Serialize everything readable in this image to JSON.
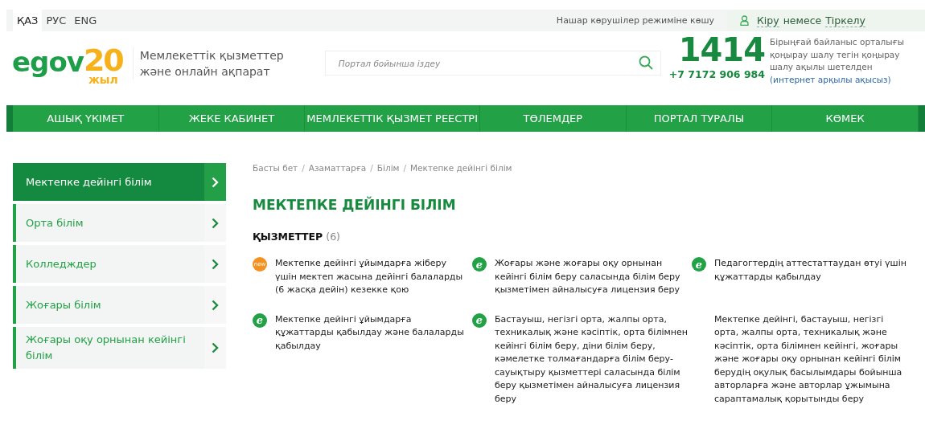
{
  "top_bar": {
    "languages": [
      {
        "label": "ҚАЗ",
        "selected": true
      },
      {
        "label": "РУС",
        "selected": false
      },
      {
        "label": "ENG",
        "selected": false
      }
    ],
    "accessibility_link": "Нашар көрушілер режиміне көшу",
    "login": {
      "sign_in": "Кіру",
      "separator": "немесе",
      "register": "Тіркелу"
    }
  },
  "header": {
    "logo": {
      "word": "egov",
      "number": "20",
      "suffix": "жыл"
    },
    "tagline": [
      "Мемлекеттік қызметтер",
      "және онлайн ақпарат"
    ],
    "search": {
      "placeholder": "Портал бойынша іздеу"
    },
    "contact": {
      "short_number": "1414",
      "phone": "+7 7172 906 984",
      "text": "Бірыңғай байланыс орталығы қоңырау шалу тегін қоңырау шалу ақылы шетелден",
      "link": "(интернет арқылы ақысыз)"
    }
  },
  "nav": [
    "АШЫҚ ҮКІМЕТ",
    "ЖЕКЕ КАБИНЕТ",
    "МЕМЛЕКЕТТІК ҚЫЗМЕТ РЕЕСТРІ",
    "ТӨЛЕМДЕР",
    "ПОРТАЛ ТУРАЛЫ",
    "КӨМЕК"
  ],
  "sidebar": {
    "items": [
      {
        "label": "Мектепке дейінгі білім",
        "selected": true
      },
      {
        "label": "Орта білім",
        "selected": false
      },
      {
        "label": "Колледждер",
        "selected": false
      },
      {
        "label": "Жоғары білім",
        "selected": false
      },
      {
        "label": "Жоғары оқу орнынан кейінгі білім",
        "selected": false
      }
    ]
  },
  "breadcrumbs": [
    "Басты бет",
    "Азаматтарға",
    "Білім",
    "Мектепке дейінгі білім"
  ],
  "breadcrumb_separator": "/",
  "page_title": "МЕКТЕПКЕ ДЕЙІНГІ БІЛІМ",
  "services": {
    "heading": "ҚЫЗМЕТТЕР",
    "count": "(6)",
    "items": [
      {
        "kind": "new",
        "badge": "new",
        "text": "Мектепке дейінгі ұйымдарға жіберу үшін мектеп жасына дейінгі балаларды (6 жасқа дейін) кезекке қою"
      },
      {
        "kind": "e",
        "badge": "e",
        "text": "Жоғары және жоғары оқу орнынан кейінгі білім беру саласында білім беру қызметімен айналысуға лицензия беру"
      },
      {
        "kind": "e",
        "badge": "e",
        "text": "Педагогтердің аттестаттаудан өтуі үшін құжаттарды қабылдау"
      },
      {
        "kind": "e",
        "badge": "e",
        "text": "Мектепке дейінгі ұйымдарға құжаттарды қабылдау және балаларды қабылдау"
      },
      {
        "kind": "e",
        "badge": "e",
        "text": "Бастауыш, негізгі орта, жалпы орта, техникалық және кәсіптік, орта білімнен кейінгі білім беру, діни білім беру, кәмелетке толмағандарға білім беру-сауықтыру қызметтері саласында білім беру қызметімен айналысуға лицензия беру"
      },
      {
        "kind": "plain",
        "text": "Мектепке дейінгі, бастауыш, негізгі орта, жалпы орта, техникалық және кәсіптік, орта білімнен кейінгі, жоғары және жоғары оқу орнынан кейінгі білім берудің оқулық басылымдары бойынша авторларға және авторлар ұжымына сараптамалық қорытынды беру"
      }
    ]
  }
}
